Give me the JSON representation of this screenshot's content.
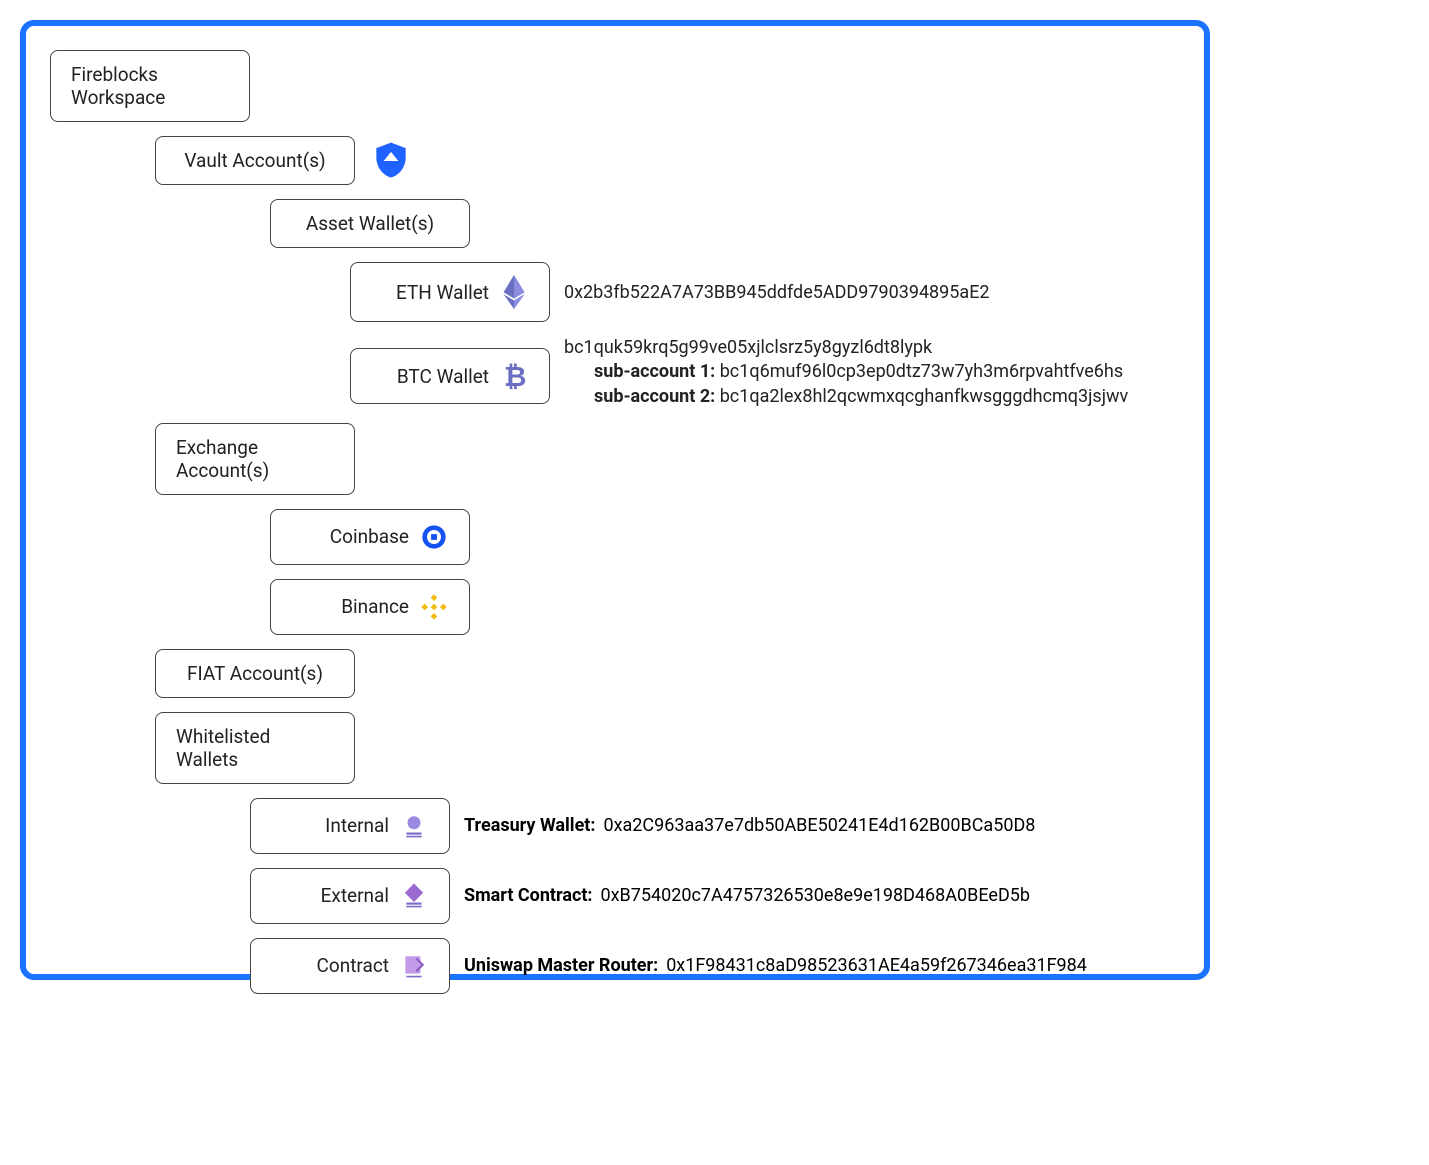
{
  "root": {
    "label": "Fireblocks Workspace"
  },
  "vault": {
    "label": "Vault Account(s)"
  },
  "asset": {
    "label": "Asset Wallet(s)"
  },
  "eth": {
    "label": "ETH Wallet",
    "address": "0x2b3fb522A7A73BB945ddfde5ADD9790394895aE2"
  },
  "btc": {
    "label": "BTC Wallet",
    "address": "bc1quk59krq5g99ve05xjlclsrz5y8gyzl6dt8lypk",
    "sub1_label": "sub-account 1:",
    "sub1_addr": "bc1q6muf96l0cp3ep0dtz73w7yh3m6rpvahtfve6hs",
    "sub2_label": "sub-account 2:",
    "sub2_addr": "bc1qa2lex8hl2qcwmxqcghanfkwsgggdhcmq3jsjwv"
  },
  "exchange": {
    "label": "Exchange Account(s)"
  },
  "coinbase": {
    "label": "Coinbase"
  },
  "binance": {
    "label": "Binance"
  },
  "fiat": {
    "label": "FIAT Account(s)"
  },
  "whitelisted": {
    "label": "Whitelisted Wallets"
  },
  "internal": {
    "label": "Internal",
    "name": "Treasury Wallet:",
    "address": "0xa2C963aa37e7db50ABE50241E4d162B00BCa50D8"
  },
  "external": {
    "label": "External",
    "name": "Smart Contract:",
    "address": "0xB754020c7A4757326530e8e9e198D468A0BEeD5b"
  },
  "contract": {
    "label": "Contract",
    "name": "Uniswap Master Router:",
    "address": "0x1F98431c8aD98523631AE4a59f267346ea31F984"
  }
}
